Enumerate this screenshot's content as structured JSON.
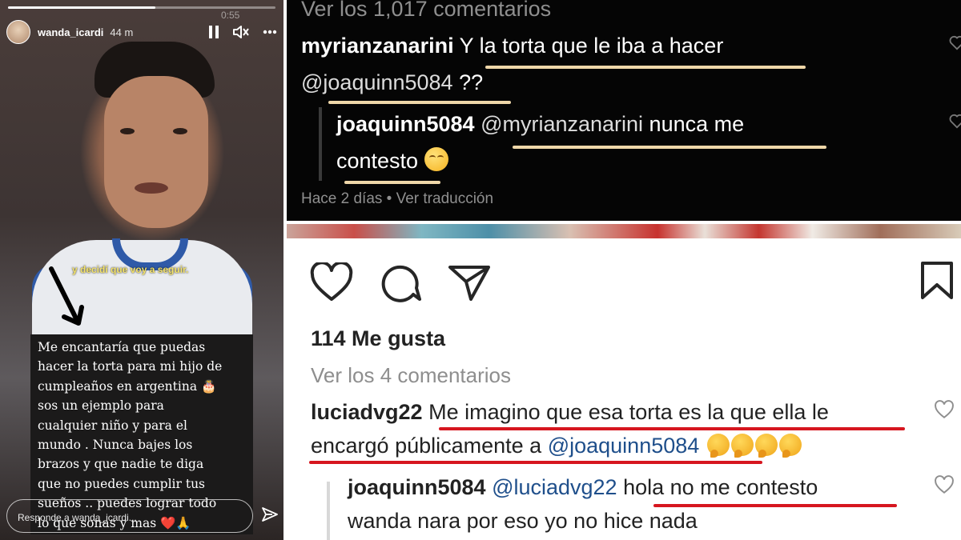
{
  "story": {
    "username": "wanda_icardi",
    "time_ago": "44 m",
    "timer": "0:55",
    "progress": 0.55,
    "subtitle": "y decidí que voy a seguir.",
    "caption_lines": [
      "Me encantaría que puedas",
      "hacer la torta para mi hijo de",
      "cumpleaños en argentina 🎂",
      "sos un ejemplo para",
      "cualquier niño  y para el",
      "mundo . Nunca bajes los",
      "brazos y que nadie te diga",
      "que no puedes cumplir tus",
      "sueños .. puedes lograr todo",
      "lo que sonas y mas ❤️🙏"
    ],
    "reply_placeholder": "Responde a wanda_icardi...",
    "icons": {
      "pause": "pause-icon",
      "mute": "mute-icon",
      "more": "more-icon",
      "send": "send-icon",
      "arrow": "arrow-down-icon"
    }
  },
  "top_comments": {
    "view_all": "Ver los 1,017 comentarios",
    "comment1": {
      "user": "myrianzanarini",
      "text_a": "Y la torta que le iba a hacer",
      "mention": "@joaquinn5084",
      "text_b": " ??"
    },
    "reply1": {
      "user": "joaquinn5084",
      "mention": "@myrianzanarini",
      "text_a": " nunca me",
      "text_b": "contesto"
    },
    "meta": "Hace 2 días • Ver traducción",
    "underline_color": "#efd7a9"
  },
  "post": {
    "likes": "114 Me gusta",
    "view_all": "Ver los 4 comentarios",
    "comment2": {
      "user": "luciadvg22",
      "text_a": "Me imagino que esa torta es la que ella le",
      "text_b": "encargó públicamente a ",
      "mention": "@joaquinn5084"
    },
    "reply2": {
      "user": "joaquinn5084",
      "mention": "@luciadvg22",
      "text_a": " hola no me contesto",
      "text_b": "wanda nara por eso yo no hice nada"
    },
    "underline_color": "#d6161f"
  }
}
